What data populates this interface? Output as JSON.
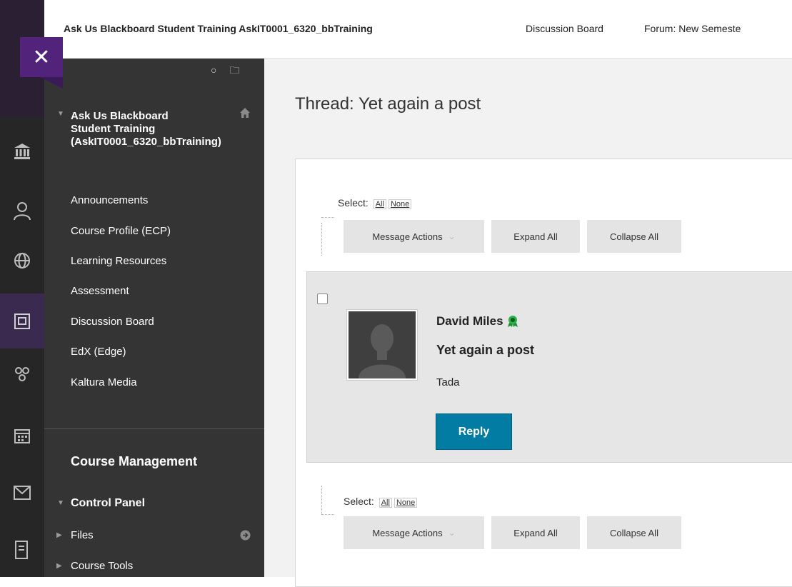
{
  "header": {
    "course": "Ask Us Blackboard Student Training AskIT0001_6320_bbTraining",
    "crumb_discussion": "Discussion Board",
    "crumb_forum": "Forum: New Semeste"
  },
  "rail": {
    "close": "✕",
    "icons": [
      "institution-icon",
      "user-icon",
      "globe-icon",
      "courses-icon",
      "groups-icon",
      "calendar-icon",
      "mail-icon",
      "grades-icon"
    ]
  },
  "course_menu": {
    "refresh_icon": "○",
    "folder_icon": "🗀",
    "course_title": "Ask Us Blackboard Student Training (AskIT0001_6320_bbTraining)",
    "items": [
      "Announcements",
      "Course Profile (ECP)",
      "Learning Resources",
      "Assessment",
      "Discussion Board",
      "EdX (Edge)",
      "Kaltura Media"
    ],
    "course_management": "Course Management",
    "control_panel": "Control Panel",
    "sub_items": [
      "Files",
      "Course Tools"
    ]
  },
  "thread": {
    "title": "Thread: Yet again a post",
    "select_label": "Select:",
    "select_all": "All",
    "select_none": "None",
    "message_actions": "Message Actions",
    "expand_all": "Expand All",
    "collapse_all": "Collapse All"
  },
  "post": {
    "author": "David Miles",
    "subject": "Yet again a post",
    "body": "Tada",
    "reply": "Reply"
  },
  "colors": {
    "accent_purple": "#51237a",
    "reply_blue": "#027ca3",
    "badge_green": "#2ab24a"
  }
}
